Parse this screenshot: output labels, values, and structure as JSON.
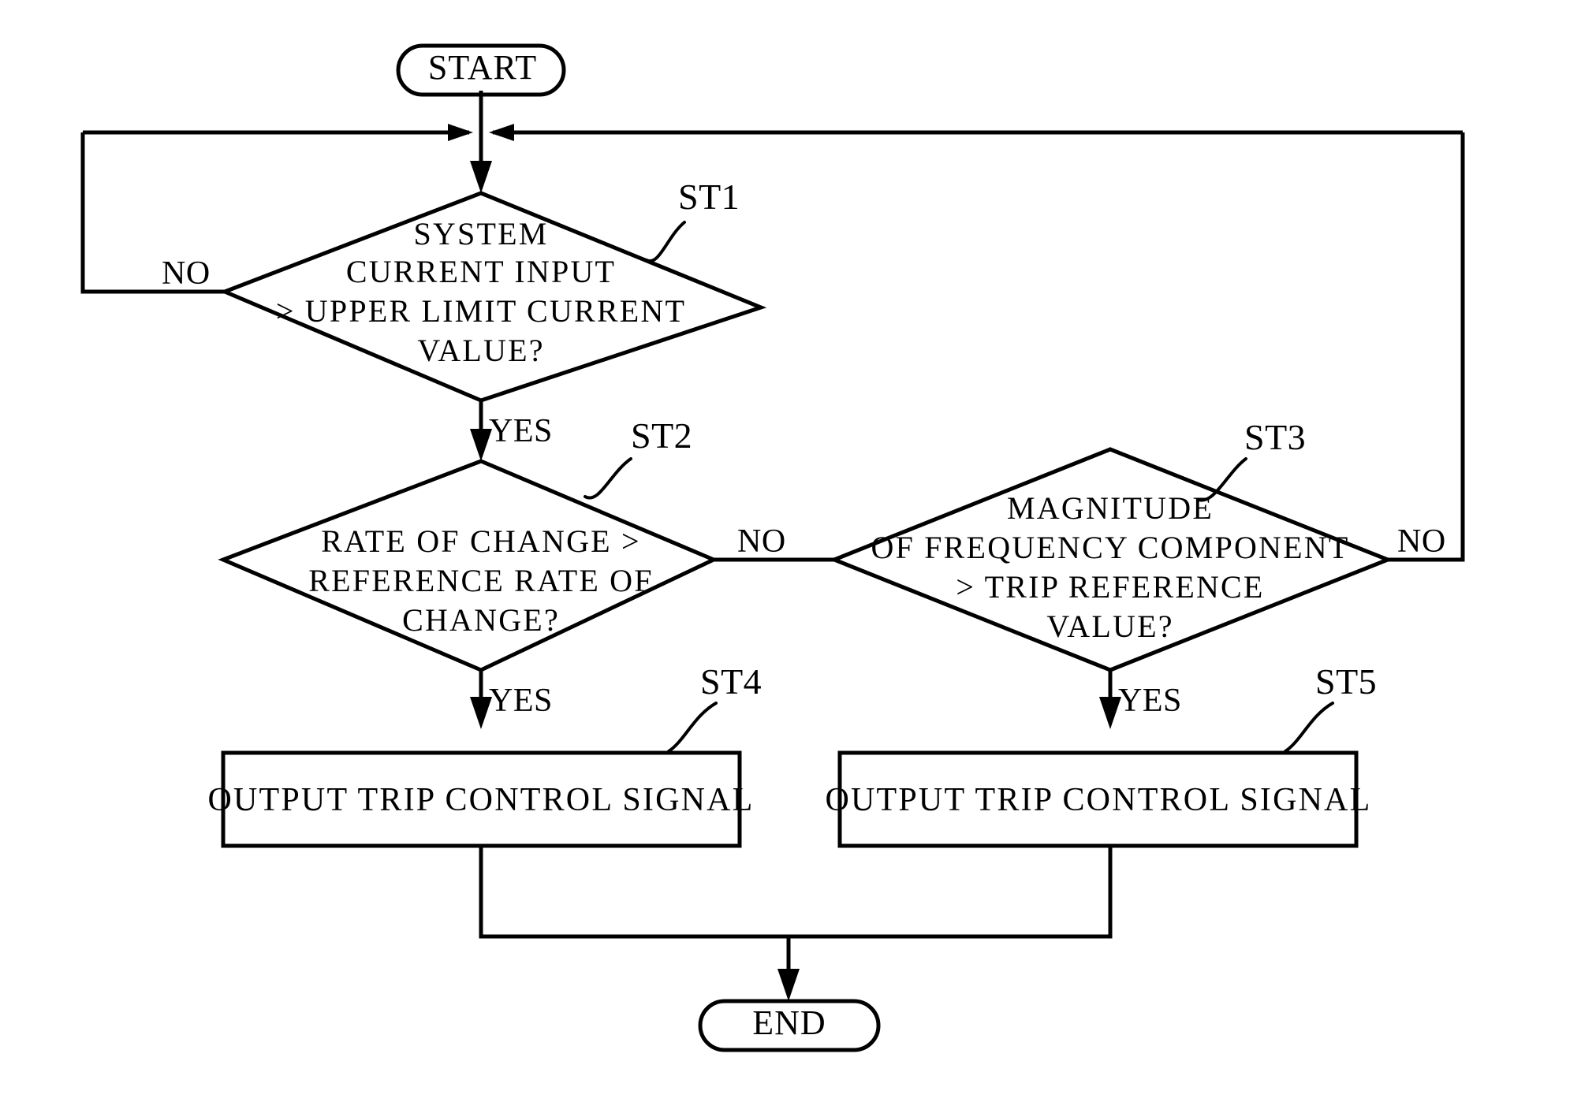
{
  "diagram": {
    "title": "Trip control decision flowchart",
    "stroke_color": "#000000",
    "background_color": "#ffffff",
    "nodes": {
      "start": {
        "id": "start",
        "type": "terminator",
        "label": "START"
      },
      "end": {
        "id": "end",
        "type": "terminator",
        "label": "END"
      },
      "st1": {
        "id": "ST1",
        "type": "decision",
        "step_label": "ST1",
        "lines": [
          "SYSTEM",
          "CURRENT INPUT",
          "> UPPER LIMIT CURRENT",
          "VALUE?"
        ]
      },
      "st2": {
        "id": "ST2",
        "type": "decision",
        "step_label": "ST2",
        "lines": [
          "RATE OF CHANGE >",
          "REFERENCE RATE OF",
          "CHANGE?"
        ]
      },
      "st3": {
        "id": "ST3",
        "type": "decision",
        "step_label": "ST3",
        "lines": [
          "MAGNITUDE",
          "OF FREQUENCY COMPONENT",
          "> TRIP REFERENCE",
          "VALUE?"
        ]
      },
      "st4": {
        "id": "ST4",
        "type": "process",
        "step_label": "ST4",
        "lines": [
          "OUTPUT TRIP CONTROL SIGNAL"
        ]
      },
      "st5": {
        "id": "ST5",
        "type": "process",
        "step_label": "ST5",
        "lines": [
          "OUTPUT TRIP CONTROL SIGNAL"
        ]
      }
    },
    "edge_labels": {
      "st1_no": "NO",
      "st1_yes": "YES",
      "st2_no": "NO",
      "st2_yes": "YES",
      "st3_no": "NO",
      "st3_yes": "YES"
    }
  }
}
